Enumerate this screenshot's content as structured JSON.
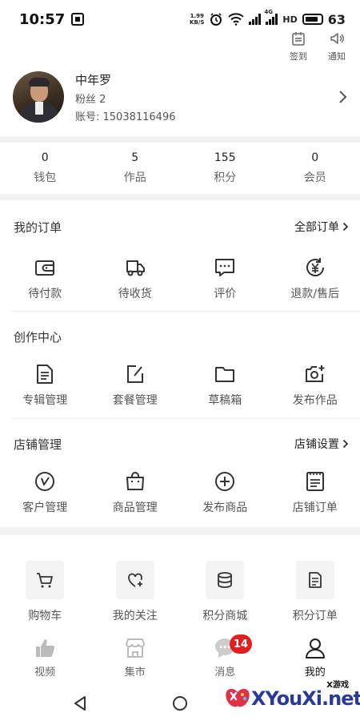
{
  "status": {
    "time": "10:57",
    "net_speed_value": "1.99",
    "net_speed_unit": "KB/S",
    "battery_pct": "63",
    "net_type": "4G",
    "hd": "HD"
  },
  "top_actions": [
    {
      "label": "签到",
      "icon": "calendar-icon"
    },
    {
      "label": "通知",
      "icon": "speaker-icon"
    }
  ],
  "profile": {
    "name": "中年罗",
    "fans": "粉丝 2",
    "account": "账号: 15038116496"
  },
  "stats": [
    {
      "value": "0",
      "label": "钱包"
    },
    {
      "value": "5",
      "label": "作品"
    },
    {
      "value": "155",
      "label": "积分"
    },
    {
      "value": "0",
      "label": "会员"
    }
  ],
  "orders": {
    "title": "我的订单",
    "link": "全部订单",
    "items": [
      {
        "label": "待付款",
        "icon": "wallet-icon"
      },
      {
        "label": "待收货",
        "icon": "truck-icon"
      },
      {
        "label": "评价",
        "icon": "comment-icon"
      },
      {
        "label": "退款/售后",
        "icon": "refund-icon"
      }
    ]
  },
  "creation": {
    "title": "创作中心",
    "items": [
      {
        "label": "专辑管理",
        "icon": "document-icon"
      },
      {
        "label": "套餐管理",
        "icon": "edit-icon"
      },
      {
        "label": "草稿箱",
        "icon": "folder-icon"
      },
      {
        "label": "发布作品",
        "icon": "camera-plus-icon"
      }
    ]
  },
  "store": {
    "title": "店铺管理",
    "link": "店铺设置",
    "items": [
      {
        "label": "客户管理",
        "icon": "compass-icon"
      },
      {
        "label": "商品管理",
        "icon": "shopping-bag-icon"
      },
      {
        "label": "发布商品",
        "icon": "plus-circle-icon"
      },
      {
        "label": "店铺订单",
        "icon": "order-list-icon"
      }
    ]
  },
  "tools": [
    {
      "label": "购物车",
      "icon": "cart-icon"
    },
    {
      "label": "我的关注",
      "icon": "heart-plus-icon"
    },
    {
      "label": "积分商城",
      "icon": "coins-icon"
    },
    {
      "label": "积分订单",
      "icon": "points-order-icon"
    }
  ],
  "tabs": [
    {
      "label": "视频",
      "icon": "thumbs-up-icon",
      "active": false
    },
    {
      "label": "集市",
      "icon": "store-icon",
      "active": false
    },
    {
      "label": "消息",
      "icon": "message-icon",
      "active": false,
      "badge": "14"
    },
    {
      "label": "我的",
      "icon": "person-icon",
      "active": true
    }
  ],
  "watermark": {
    "text": "XYouXi.net",
    "small": "X游戏"
  }
}
